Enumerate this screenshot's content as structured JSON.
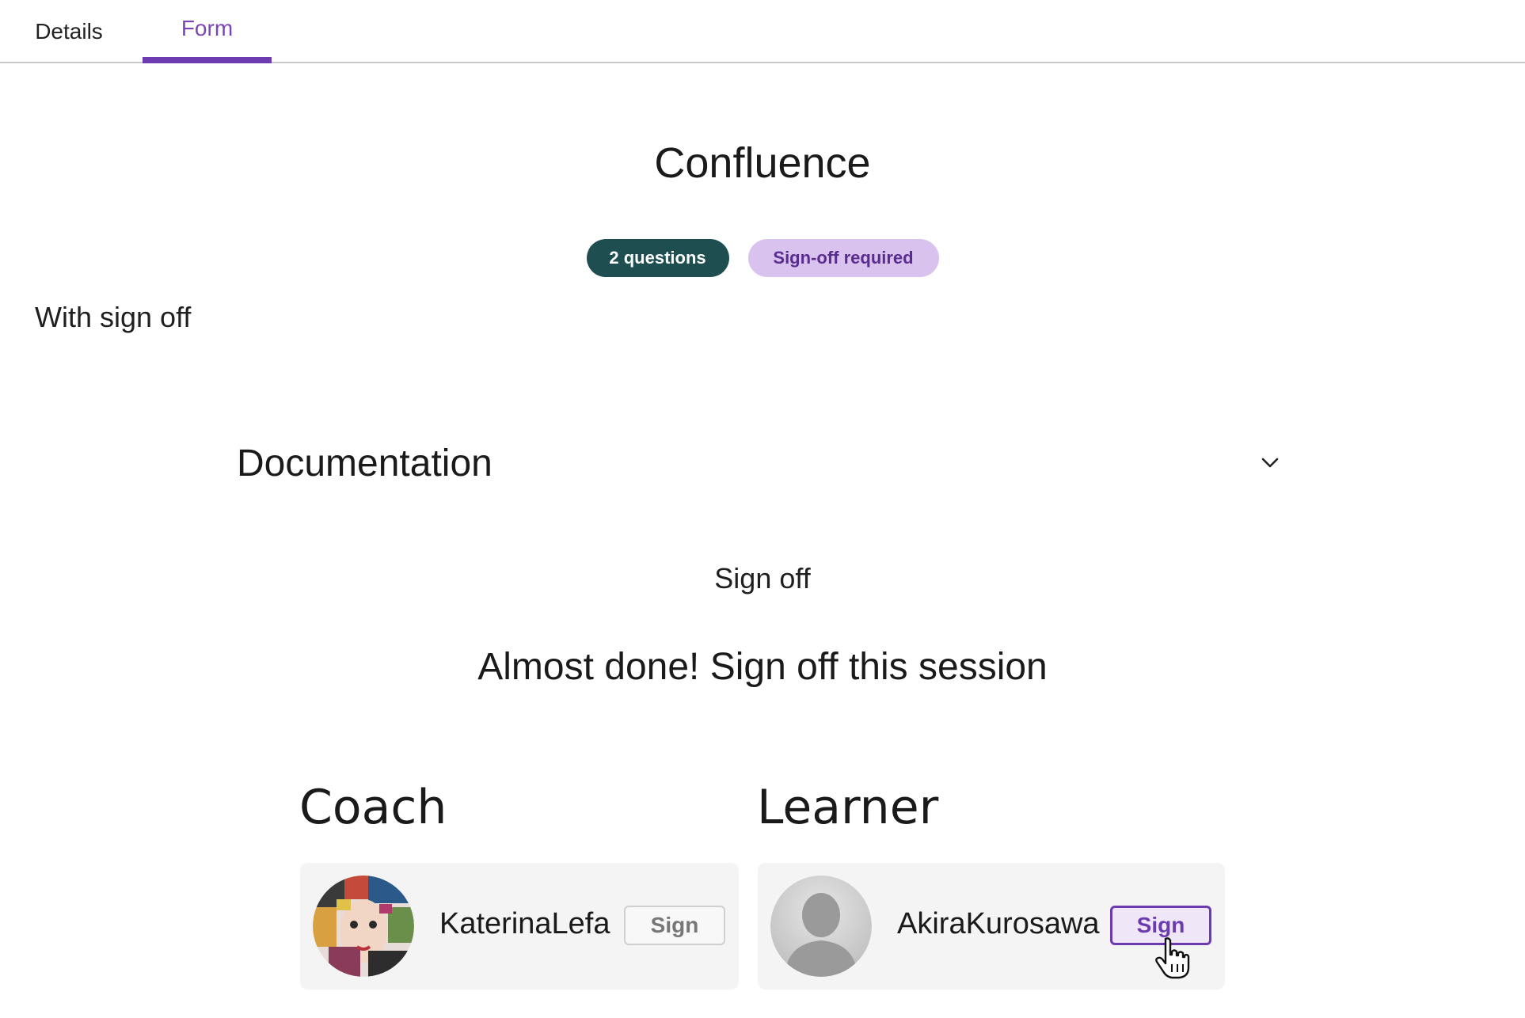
{
  "tabs": [
    {
      "label": "Details",
      "active": false
    },
    {
      "label": "Form",
      "active": true
    }
  ],
  "form": {
    "title": "Confluence",
    "badges": {
      "questions": "2 questions",
      "signoff": "Sign-off required"
    },
    "subtitle": "With sign off"
  },
  "section": {
    "title": "Documentation",
    "toggle_icon": "chevron-down-icon"
  },
  "signoff": {
    "label": "Sign off",
    "heading": "Almost done! Sign off this session",
    "coach": {
      "role": "Coach",
      "name": "KaterinaLefa",
      "button": "Sign",
      "button_enabled": false,
      "avatar_icon": "avatar-photo"
    },
    "learner": {
      "role": "Learner",
      "name": "AkiraKurosawa",
      "button": "Sign",
      "button_enabled": true,
      "avatar_icon": "avatar-placeholder-icon"
    }
  },
  "colors": {
    "accent": "#6c3bb0",
    "badge_questions_bg": "#1e4e4f",
    "badge_signoff_bg": "#d9c2ee"
  }
}
